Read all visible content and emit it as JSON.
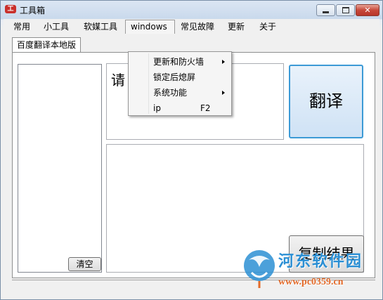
{
  "window": {
    "title": "工具箱",
    "app_icon_text": "工"
  },
  "menubar": {
    "items": [
      "常用",
      "小工具",
      "软媒工具",
      "windows",
      "常见故障",
      "更新",
      "关于"
    ],
    "open_item": "windows"
  },
  "windows_menu": {
    "items": [
      {
        "label": "更新和防火墙",
        "shortcut": "",
        "submenu": true
      },
      {
        "label": "锁定后熄屏",
        "shortcut": "",
        "submenu": false
      },
      {
        "label": "系统功能",
        "shortcut": "",
        "submenu": true
      },
      {
        "label": "ip",
        "shortcut": "F2",
        "submenu": false
      }
    ]
  },
  "tab": {
    "label": "百度翻译本地版"
  },
  "translator": {
    "input_text": "请",
    "translate_label": "翻译",
    "copy_label": "复制结果",
    "clear_label": "清空"
  },
  "watermark": {
    "text": "河东软件园",
    "url": "www.pc0359.cn"
  },
  "colors": {
    "accent": "#3c9ad6",
    "close_button": "#c7483a",
    "watermark_blue": "#2b8fd4",
    "watermark_orange": "#e46b2a"
  }
}
